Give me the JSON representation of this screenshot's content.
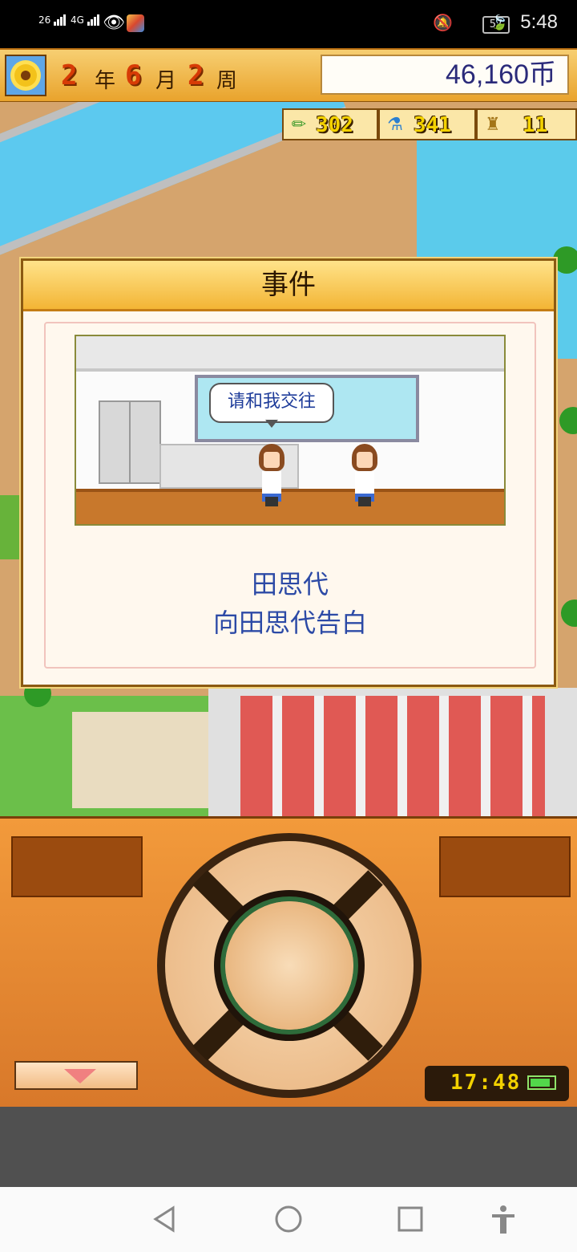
{
  "status_bar": {
    "signal1": "26",
    "signal2": "4G",
    "battery": "57",
    "time": "5:48",
    "icons": [
      "signal-icon",
      "eye-icon",
      "app-icon",
      "mute-icon",
      "battery-icon",
      "leaf-icon"
    ]
  },
  "top_bar": {
    "year_num": "2",
    "year_unit": "年",
    "month_num": "6",
    "month_unit": "月",
    "week_num": "2",
    "week_unit": "周",
    "money": "46,160币"
  },
  "stats": {
    "stat1": "302",
    "stat2": "341",
    "stat3": "11"
  },
  "dialog": {
    "title": "事件",
    "speech": "请和我交往",
    "name": "田思代",
    "description": "向田思代告白"
  },
  "controls": {
    "clock": "17:48"
  },
  "colors": {
    "accent_orange": "#f29a3b",
    "dialog_text": "#2c4aa6",
    "money_text": "#2a2a7a"
  }
}
